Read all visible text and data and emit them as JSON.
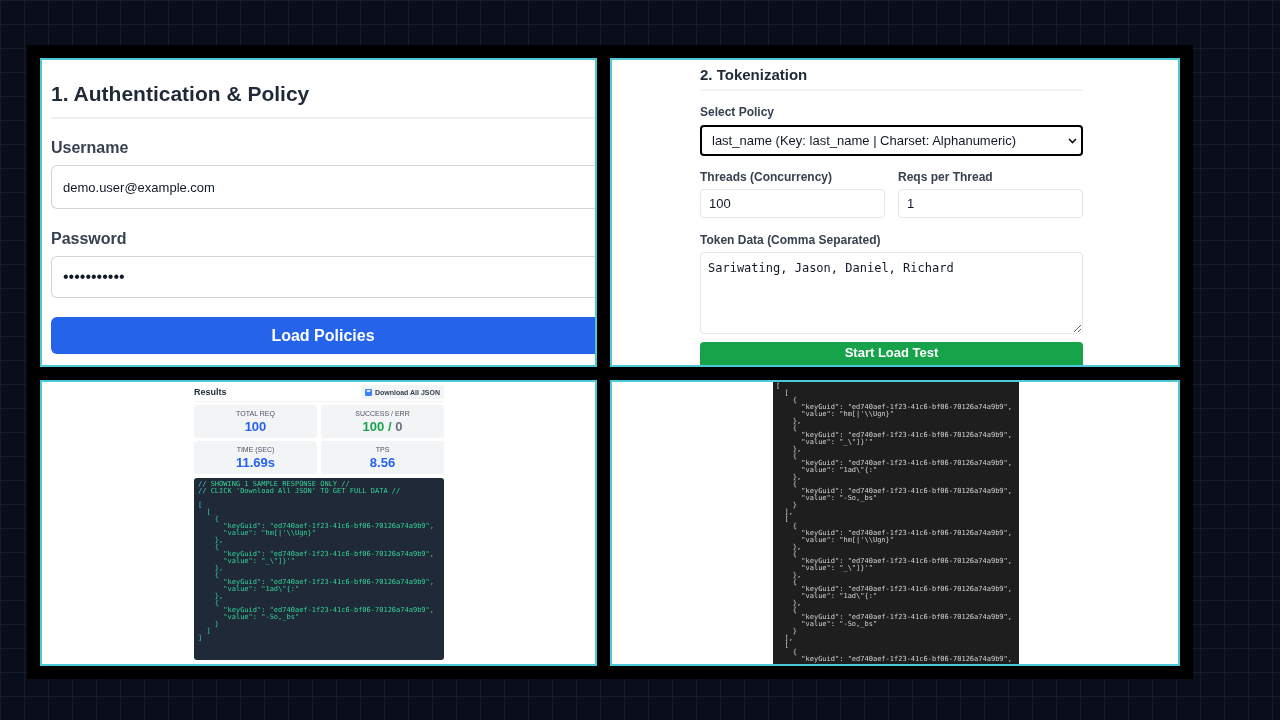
{
  "auth_panel": {
    "title": "1. Authentication & Policy",
    "fields": [
      {
        "label": "Username",
        "value": "demo.user@example.com",
        "kind": "text"
      },
      {
        "label": "Password",
        "value": "•••••••••••",
        "kind": "password"
      }
    ],
    "button": "Load Policies"
  },
  "tokenization_panel": {
    "title": "2. Tokenization",
    "policy": {
      "label": "Select Policy",
      "value": "last_name (Key: last_name | Charset: Alphanumeric)",
      "focused": true
    },
    "numbers": [
      {
        "label": "Threads (Concurrency)",
        "value": "100"
      },
      {
        "label": "Reqs per Thread",
        "value": "1"
      }
    ],
    "token_data": {
      "label": "Token Data (Comma Separated)",
      "value": "Sariwating, Jason, Daniel, Richard"
    },
    "button": "Start Load Test"
  },
  "results_panel": {
    "title": "Results",
    "download_button": "Download All JSON",
    "stats": [
      {
        "label": "TOTAL REQ",
        "parts": [
          {
            "text": "100",
            "kind": "primary"
          }
        ]
      },
      {
        "label": "SUCCESS / ERR",
        "parts": [
          {
            "text": "100",
            "kind": "success"
          },
          {
            "text": "/",
            "kind": "success"
          },
          {
            "text": "0",
            "kind": "muted"
          }
        ]
      },
      {
        "label": "TIME (SEC)",
        "parts": [
          {
            "text": "11.69s",
            "kind": "primary"
          }
        ]
      },
      {
        "label": "TPS",
        "parts": [
          {
            "text": "8.56",
            "kind": "primary"
          }
        ]
      }
    ],
    "comments": [
      "// SHOWING 1 SAMPLE RESPONSE ONLY //",
      "// CLICK 'Download All JSON' TO GET FULL DATA //"
    ],
    "code": [
      "[",
      "  [",
      "    {",
      "      \"keyGuid\": \"ed740aef-1f23-41c6-bf06-70126a74a9b9\",",
      "      \"value\": \"hm[|'\\\\Ugn}\"",
      "    },",
      "    {",
      "      \"keyGuid\": \"ed740aef-1f23-41c6-bf06-70126a74a9b9\",",
      "      \"value\": \"_\\\"]}'\"",
      "    },",
      "    {",
      "      \"keyGuid\": \"ed740aef-1f23-41c6-bf06-70126a74a9b9\",",
      "      \"value\": \"1ad\\\"{:\"",
      "    },",
      "    {",
      "      \"keyGuid\": \"ed740aef-1f23-41c6-bf06-70126a74a9b9\",",
      "      \"value\": \"-So,_bs\"",
      "    }",
      "  ]",
      "]"
    ]
  },
  "json_panel": {
    "lines": [
      "[",
      "  [",
      "    {",
      "      \"keyGuid\": \"ed740aef-1f23-41c6-bf06-70126a74a9b9\",",
      "      \"value\": \"hm[|'\\\\Ugn}\"",
      "    },",
      "    {",
      "      \"keyGuid\": \"ed740aef-1f23-41c6-bf06-70126a74a9b9\",",
      "      \"value\": \"_\\\"]}'\"",
      "    },",
      "    {",
      "      \"keyGuid\": \"ed740aef-1f23-41c6-bf06-70126a74a9b9\",",
      "      \"value\": \"1ad\\\"{:\"",
      "    },",
      "    {",
      "      \"keyGuid\": \"ed740aef-1f23-41c6-bf06-70126a74a9b9\",",
      "      \"value\": \"-So,_bs\"",
      "    }",
      "  ],",
      "  [",
      "    {",
      "      \"keyGuid\": \"ed740aef-1f23-41c6-bf06-70126a74a9b9\",",
      "      \"value\": \"hm[|'\\\\Ugn}\"",
      "    },",
      "    {",
      "      \"keyGuid\": \"ed740aef-1f23-41c6-bf06-70126a74a9b9\",",
      "      \"value\": \"_\\\"]}'\"",
      "    },",
      "    {",
      "      \"keyGuid\": \"ed740aef-1f23-41c6-bf06-70126a74a9b9\",",
      "      \"value\": \"1ad\\\"{:\"",
      "    },",
      "    {",
      "      \"keyGuid\": \"ed740aef-1f23-41c6-bf06-70126a74a9b9\",",
      "      \"value\": \"-So,_bs\"",
      "    }",
      "  ],",
      "  [",
      "    {",
      "      \"keyGuid\": \"ed740aef-1f23-41c6-bf06-70126a74a9b9\","
    ]
  }
}
